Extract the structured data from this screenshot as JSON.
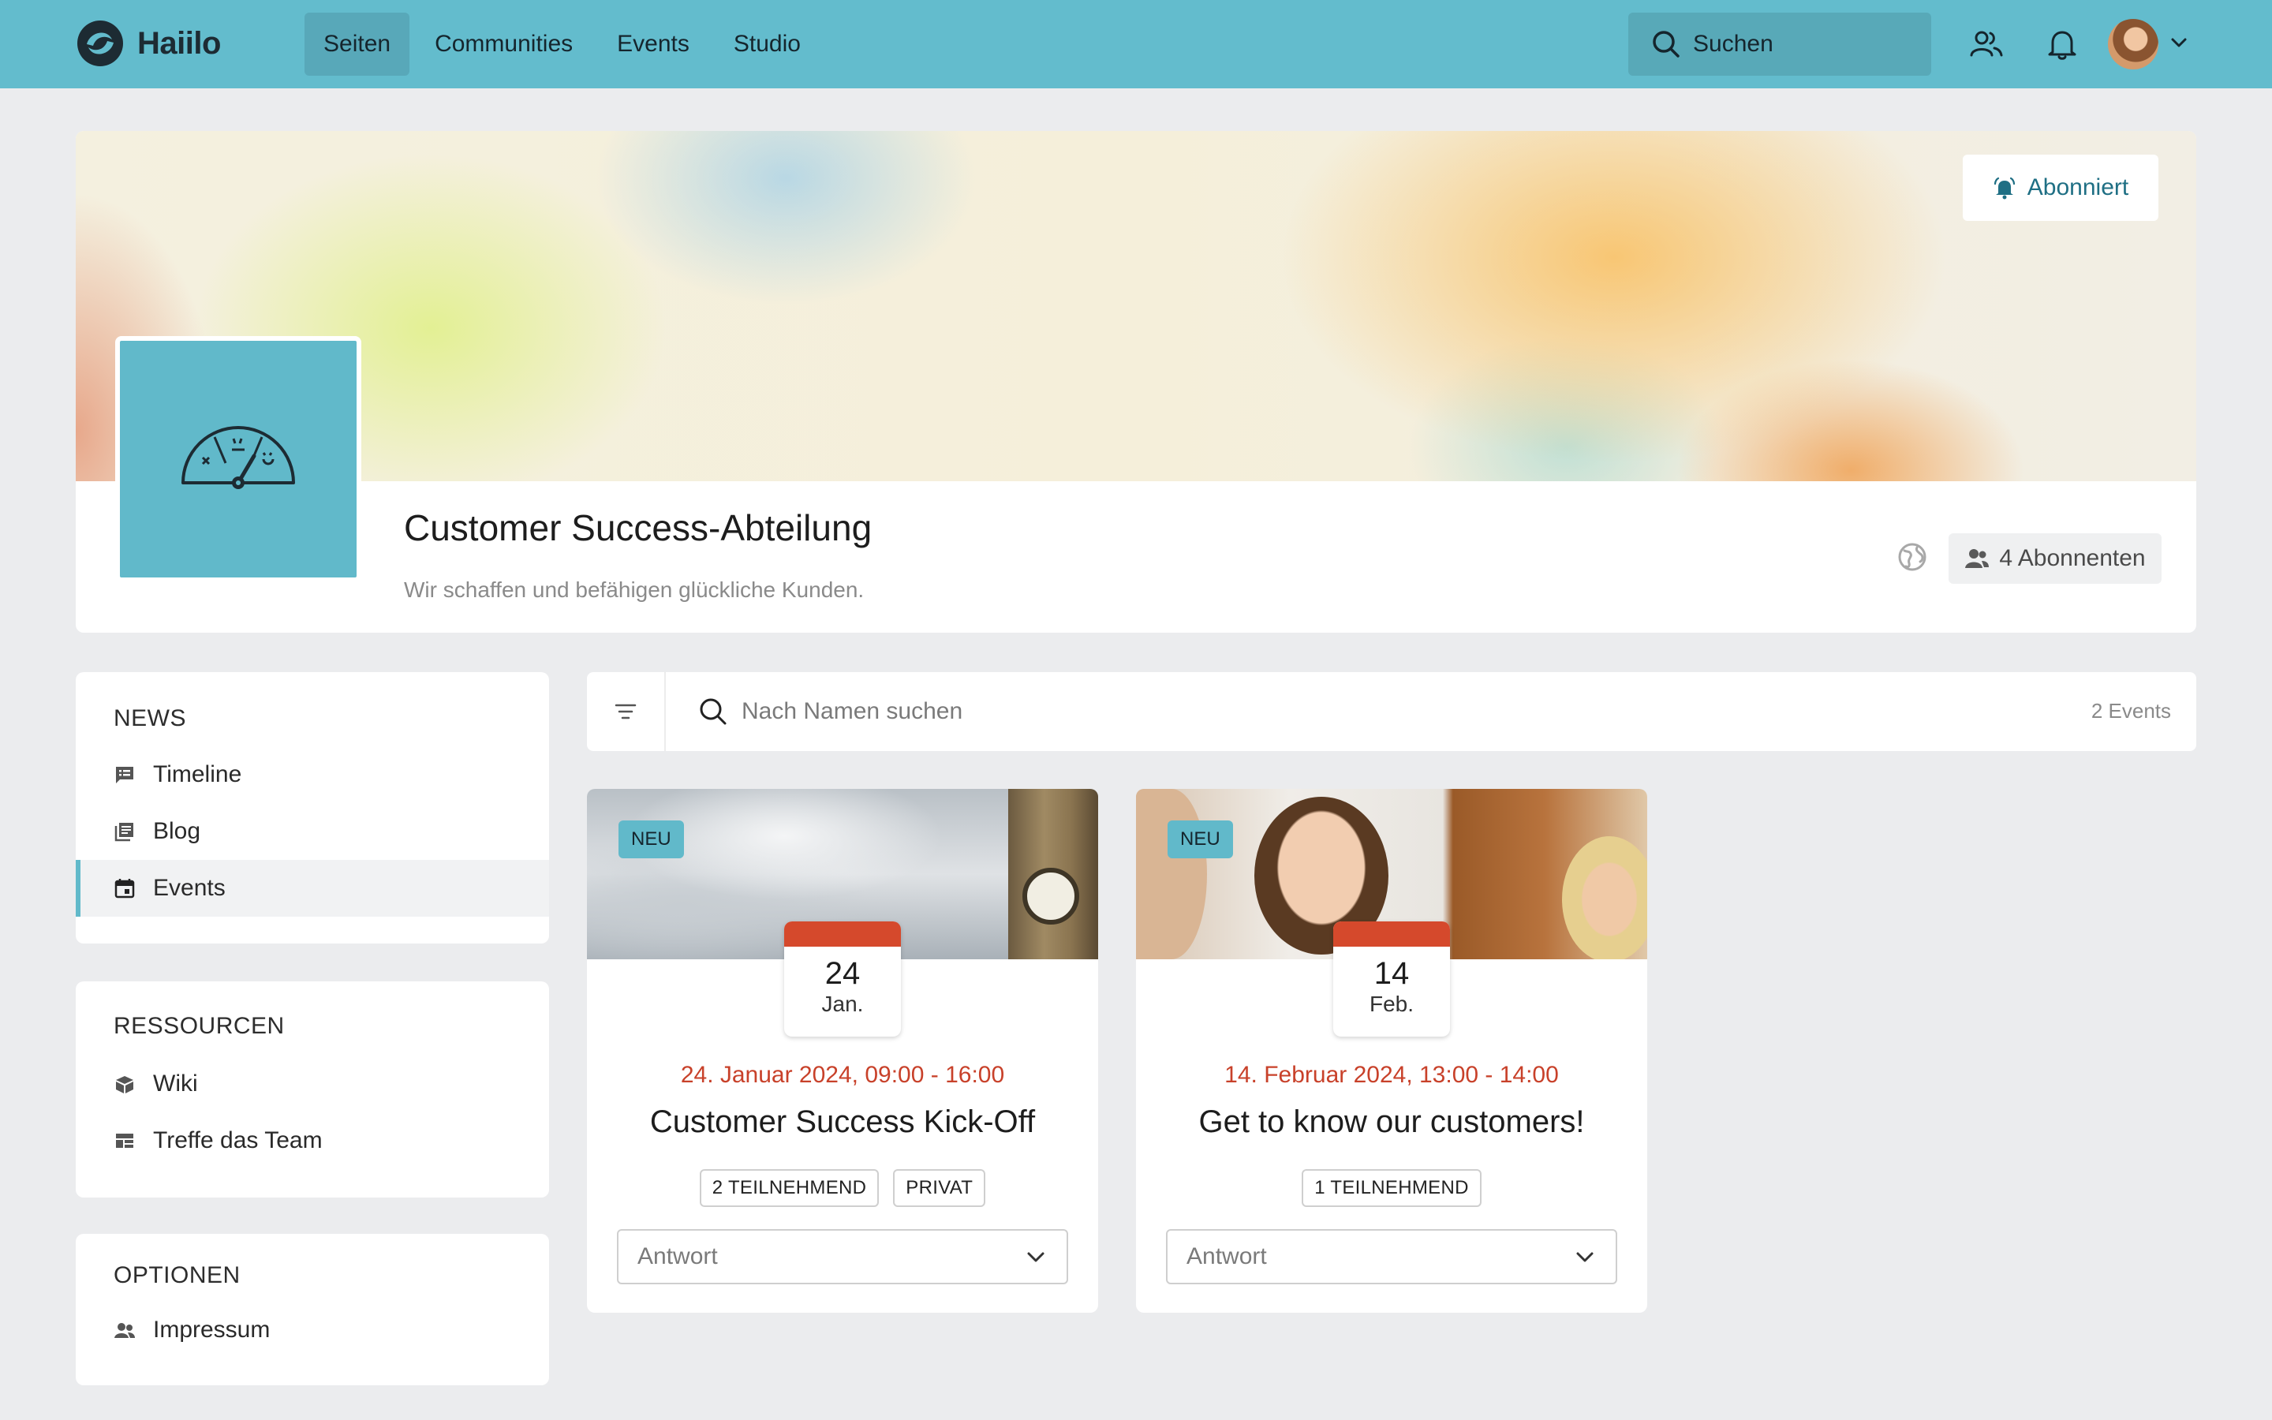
{
  "app": {
    "name": "Haiilo"
  },
  "colors": {
    "primary": "#63bccd",
    "accent_red": "#c8412a",
    "date_band": "#d5492c",
    "badge": "#61b9ca"
  },
  "nav": {
    "items": [
      {
        "label": "Seiten",
        "active": true
      },
      {
        "label": "Communities",
        "active": false
      },
      {
        "label": "Events",
        "active": false
      },
      {
        "label": "Studio",
        "active": false
      }
    ],
    "search_label": "Suchen",
    "icons": [
      "people-icon",
      "bell-icon",
      "avatar",
      "chevron-down-icon"
    ]
  },
  "page": {
    "title": "Customer Success-Abteilung",
    "subtitle": "Wir schaffen und befähigen glückliche Kunden.",
    "subscribe_label": "Abonniert",
    "subscribers_label": "4 Abonnenten"
  },
  "sidebar": {
    "sections": [
      {
        "heading": "NEWS",
        "items": [
          {
            "label": "Timeline",
            "icon": "timeline-icon"
          },
          {
            "label": "Blog",
            "icon": "blog-icon"
          },
          {
            "label": "Events",
            "icon": "calendar-icon",
            "active": true
          }
        ]
      },
      {
        "heading": "RESSOURCEN",
        "items": [
          {
            "label": "Wiki",
            "icon": "wiki-icon"
          },
          {
            "label": "Treffe das Team",
            "icon": "team-table-icon"
          }
        ]
      },
      {
        "heading": "OPTIONEN",
        "items": [
          {
            "label": "Impressum",
            "icon": "people-icon"
          }
        ]
      }
    ]
  },
  "events_filter": {
    "placeholder": "Nach Namen suchen",
    "count_label": "2 Events"
  },
  "events": [
    {
      "badge": "NEU",
      "day": "24",
      "month": "Jan.",
      "when": "24. Januar 2024, 09:00 - 16:00",
      "title": "Customer Success Kick-Off",
      "chips": [
        "2  TEILNEHMEND",
        "PRIVAT"
      ],
      "answer_placeholder": "Antwort"
    },
    {
      "badge": "NEU",
      "day": "14",
      "month": "Feb.",
      "when": "14. Februar 2024, 13:00 - 14:00",
      "title": "Get to know our customers!",
      "chips": [
        "1  TEILNEHMEND"
      ],
      "answer_placeholder": "Antwort"
    }
  ]
}
